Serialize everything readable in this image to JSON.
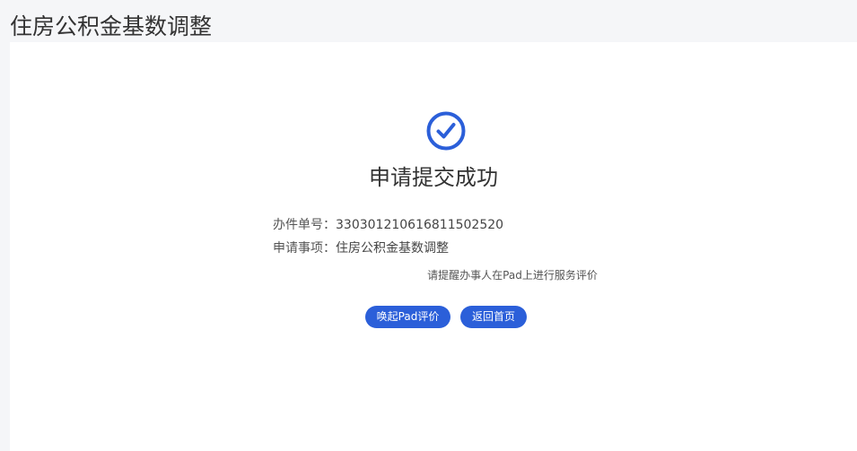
{
  "page": {
    "title": "住房公积金基数调整"
  },
  "result": {
    "icon": "check-circle-icon",
    "title": "申请提交成功",
    "accent_color": "#2b5fd9"
  },
  "details": {
    "number_label": "办件单号：",
    "number_value": "330301210616811502520",
    "matter_label": "申请事项：",
    "matter_value": "住房公积金基数调整"
  },
  "reminder": "请提醒办事人在Pad上进行服务评价",
  "actions": {
    "pad_review_label": "唤起Pad评价",
    "home_label": "返回首页"
  }
}
